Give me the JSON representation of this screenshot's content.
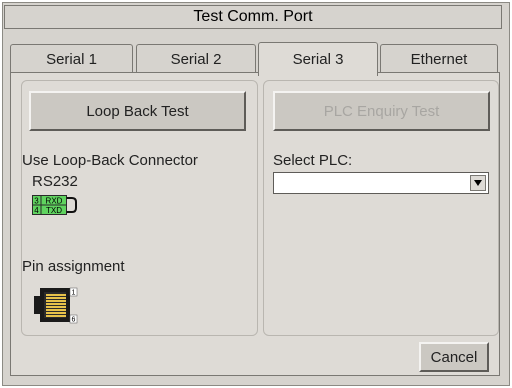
{
  "window": {
    "title": "Test Comm. Port"
  },
  "tabs": [
    {
      "label": "Serial 1",
      "active": false
    },
    {
      "label": "Serial 2",
      "active": false
    },
    {
      "label": "Serial 3",
      "active": true
    },
    {
      "label": "Ethernet",
      "active": false
    }
  ],
  "left_panel": {
    "loopback_button": "Loop Back Test",
    "connector_label": "Use Loop-Back Connector",
    "interface": "RS232",
    "pins": [
      {
        "number": "3",
        "signal": "RXD"
      },
      {
        "number": "4",
        "signal": "TXD"
      }
    ],
    "pin_assignment_label": "Pin assignment",
    "pin_top": "1",
    "pin_bottom": "6"
  },
  "right_panel": {
    "enquiry_button": "PLC Enquiry Test",
    "enquiry_enabled": false,
    "select_label": "Select PLC:",
    "select_value": ""
  },
  "footer": {
    "cancel_button": "Cancel"
  },
  "colors": {
    "connector_green": "#5fd35f",
    "panel_bg": "#dedbd6",
    "disabled_text": "#a8a6a2"
  }
}
